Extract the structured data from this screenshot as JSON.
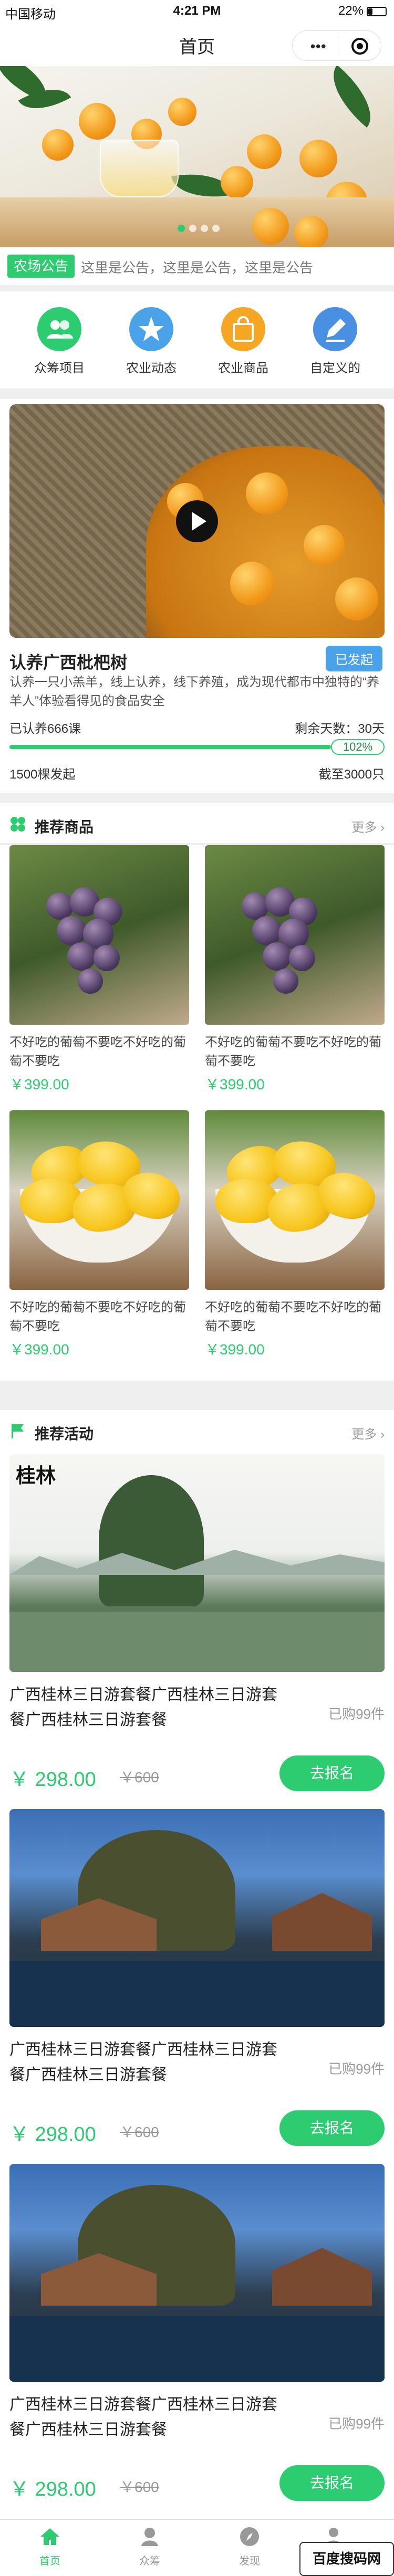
{
  "status_bar": {
    "carrier": "中国移动",
    "time": "4:21 PM",
    "battery": "22%"
  },
  "nav": {
    "title": "首页",
    "more_icon": "more-dots-icon",
    "close_icon": "target-icon"
  },
  "banner": {
    "slide_count": 4,
    "active_index": 0
  },
  "notice": {
    "tag": "农场公告",
    "text": "这里是公告，这里是公告，这里是公告"
  },
  "categories": [
    {
      "label": "众筹项目",
      "icon": "people-icon",
      "color": "#2ecc71"
    },
    {
      "label": "农业动态",
      "icon": "star-icon",
      "color": "#4aa3e8"
    },
    {
      "label": "农业商品",
      "icon": "bag-icon",
      "color": "#f5a623"
    },
    {
      "label": "自定义的",
      "icon": "edit-icon",
      "color": "#4a90e2"
    }
  ],
  "feature": {
    "title": "认养广西枇杷树",
    "badge": "已发起",
    "desc": "认养一只小羔羊，线上认养，线下养殖，成为现代都市中独特的“养羊人”体验看得见的食品安全",
    "adopted": "已认养666课",
    "remaining": "剩余天数：30天",
    "progress_label": "102%",
    "progress": 1.02,
    "started": "1500棵发起",
    "deadline": "截至3000只"
  },
  "goods_section": {
    "title": "推荐商品",
    "more": "更多",
    "icon": "grid-icon"
  },
  "goods": [
    {
      "name": "不好吃的葡萄不要吃不好吃的葡萄不要吃",
      "price": "￥399.00",
      "kind": "grape"
    },
    {
      "name": "不好吃的葡萄不要吃不好吃的葡萄不要吃",
      "price": "￥399.00",
      "kind": "grape"
    },
    {
      "name": "不好吃的葡萄不要吃不好吃的葡萄不要吃",
      "price": "￥399.00",
      "kind": "mango"
    },
    {
      "name": "不好吃的葡萄不要吃不好吃的葡萄不要吃",
      "price": "￥399.00",
      "kind": "mango"
    }
  ],
  "activity_section": {
    "title": "推荐活动",
    "more": "更多",
    "icon": "flag-icon"
  },
  "activities": [
    {
      "name": "广西桂林三日游套餐广西桂林三日游套餐广西桂林三日游套餐",
      "sold": "已购99件",
      "price": "￥ 298.00",
      "old_price": "￥600",
      "button": "去报名",
      "image_caption": "桂林"
    },
    {
      "name": "广西桂林三日游套餐广西桂林三日游套餐广西桂林三日游套餐",
      "sold": "已购99件",
      "price": "￥ 298.00",
      "old_price": "￥600",
      "button": "去报名"
    },
    {
      "name": "广西桂林三日游套餐广西桂林三日游套餐广西桂林三日游套餐",
      "sold": "已购99件",
      "price": "￥ 298.00",
      "old_price": "￥600",
      "button": "去报名"
    }
  ],
  "tabbar": [
    {
      "label": "首页",
      "icon": "home-icon",
      "active": true
    },
    {
      "label": "众筹",
      "icon": "crowdfund-icon",
      "active": false
    },
    {
      "label": "发现",
      "icon": "compass-icon",
      "active": false
    },
    {
      "label": "我的",
      "icon": "user-icon",
      "active": false
    }
  ],
  "watermark": "百度搜码网",
  "colors": {
    "accent": "#2ecc71",
    "badge_blue": "#4aa3e8",
    "bg": "#efefef"
  }
}
